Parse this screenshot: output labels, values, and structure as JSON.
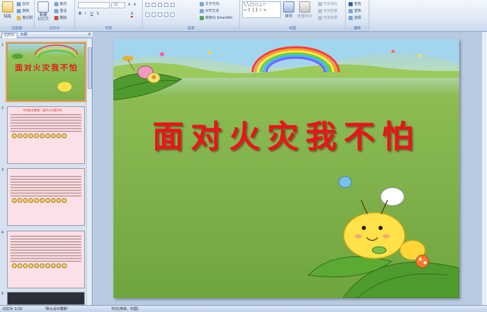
{
  "ribbon": {
    "clipboard": {
      "label": "剪贴板",
      "paste": "粘贴",
      "cut": "剪切",
      "copy": "复制",
      "format_painter": "格式刷"
    },
    "slides": {
      "label": "幻灯片",
      "new_slide": "新建\n幻灯片",
      "layout": "版式",
      "reset": "重设",
      "delete": "删除"
    },
    "font": {
      "label": "字体",
      "font_size": "32"
    },
    "paragraph": {
      "label": "段落",
      "text_direction": "文字方向",
      "align_text": "对齐文本",
      "smartart": "转换为 SmartArt"
    },
    "drawing": {
      "label": "绘图",
      "arrange": "排列",
      "quick_styles": "快速样式",
      "shape_fill": "形状填充",
      "shape_outline": "形状轮廓",
      "shape_effects": "形状效果"
    },
    "editing": {
      "label": "编辑",
      "find": "查找",
      "replace": "替换",
      "select": "选择"
    }
  },
  "left_pane": {
    "tab_slides": "幻灯片",
    "tab_outline": "大纲",
    "thumbnails": [
      {
        "number": "1",
        "title": "面对火灾我不怕"
      },
      {
        "number": "2",
        "title": "中班安全教育：面对火灾我不怕"
      },
      {
        "number": "3",
        "title": ""
      },
      {
        "number": "4",
        "title": ""
      },
      {
        "number": "5",
        "title": ""
      }
    ]
  },
  "slide": {
    "title": "面对火灾我不怕"
  },
  "status": {
    "slide_info": "幻灯片 1/19",
    "theme": "\"默认设计模板\"",
    "language": "中文(简体，中国)"
  }
}
